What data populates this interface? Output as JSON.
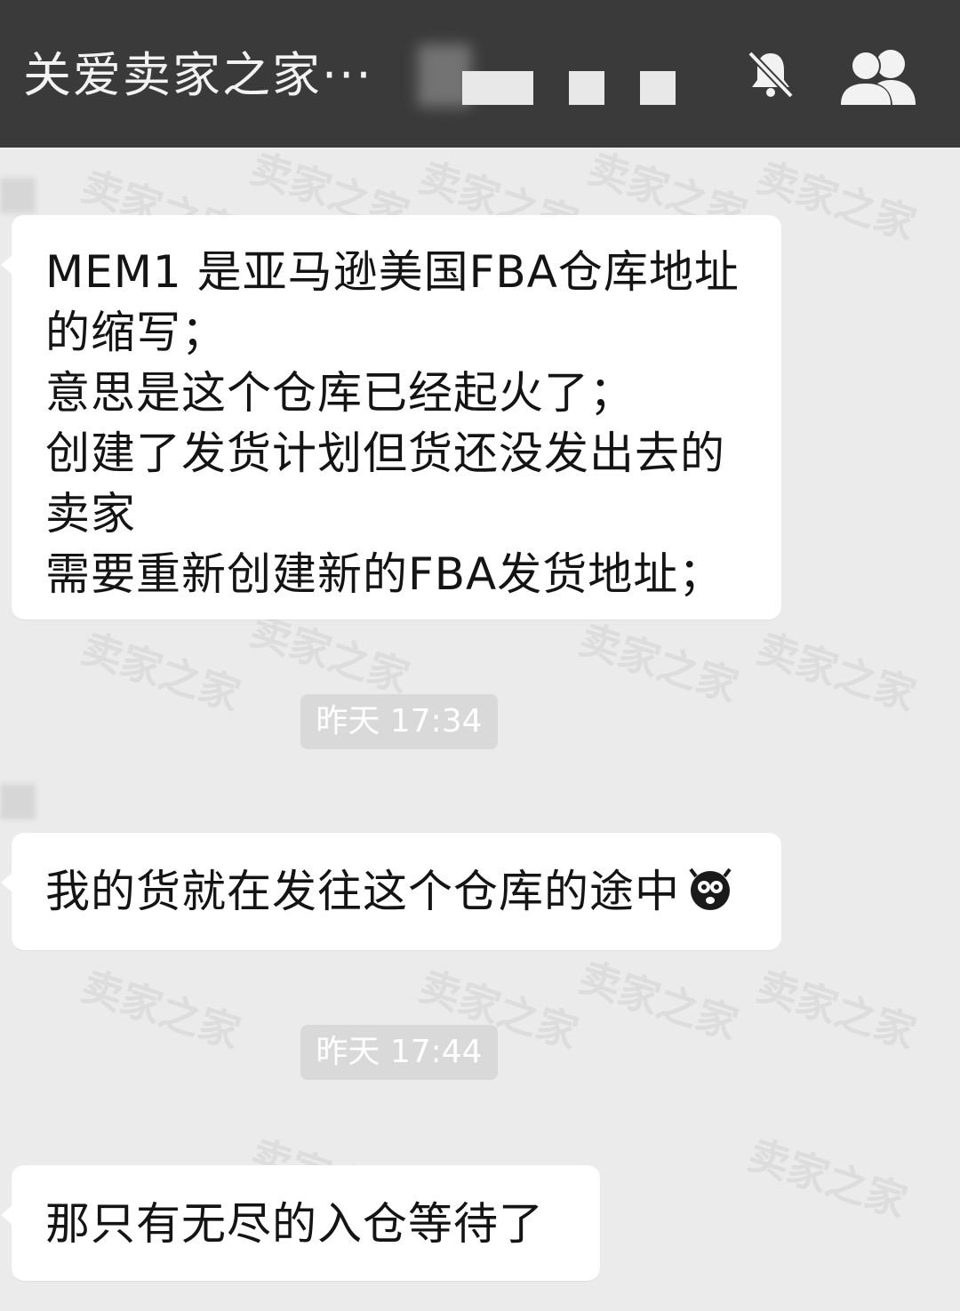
{
  "header": {
    "title": "关爱卖家之家···",
    "icons": {
      "mute": "mute-bell-icon",
      "members": "group-members-icon"
    }
  },
  "watermark": "卖家之家",
  "messages": [
    {
      "text": "MEM1 是亚马逊美国FBA仓库地址\n的缩写；\n意思是这个仓库已经起火了；\n创建了发货计划但货还没发出去的\n卖家\n需要重新创建新的FBA发货地址；"
    },
    {
      "time": "昨天 17:34"
    },
    {
      "text": "我的货就在发往这个仓库的途中",
      "emoji": "scared-face-emoji"
    },
    {
      "time": "昨天 17:44"
    },
    {
      "text": "那只有无尽的入仓等待了"
    }
  ]
}
